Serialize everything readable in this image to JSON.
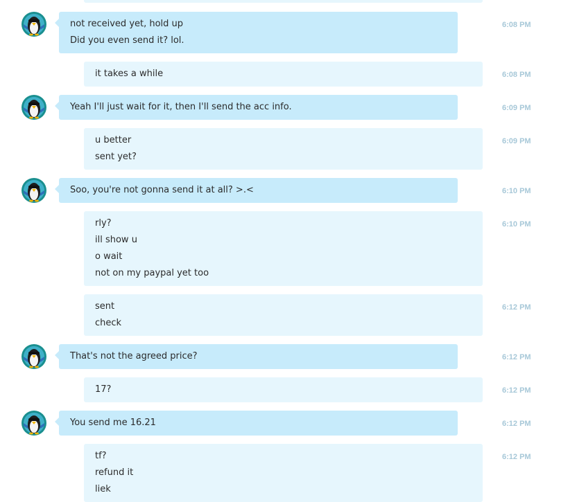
{
  "avatar_icon": "penguin-with-sunglasses",
  "colors": {
    "incoming_bubble": "#c7ebfb",
    "outgoing_bubble": "#e6f6fd",
    "timestamp": "#a7c8d8",
    "avatar_ring": "#1a8f8f"
  },
  "messages": [
    {
      "direction": "in",
      "time": "6:08 PM",
      "lines": [
        "not received yet, hold up",
        "Did you even send it? lol."
      ]
    },
    {
      "direction": "out",
      "time": "6:08 PM",
      "lines": [
        "it takes a while"
      ]
    },
    {
      "direction": "in",
      "time": "6:09 PM",
      "lines": [
        "Yeah I'll just wait for it, then I'll send the acc info."
      ]
    },
    {
      "direction": "out",
      "time": "6:09 PM",
      "lines": [
        "u better",
        "sent yet?"
      ]
    },
    {
      "direction": "in",
      "time": "6:10 PM",
      "lines": [
        "Soo, you're not gonna send it at all? >.<"
      ]
    },
    {
      "direction": "out",
      "time": "6:10 PM",
      "lines": [
        "rly?",
        "ill show u",
        "o wait",
        "not on my paypal yet too"
      ]
    },
    {
      "direction": "out",
      "time": "6:12 PM",
      "lines": [
        "sent",
        "check"
      ]
    },
    {
      "direction": "in",
      "time": "6:12 PM",
      "lines": [
        "That's not the agreed price?"
      ]
    },
    {
      "direction": "out",
      "time": "6:12 PM",
      "lines": [
        "17?"
      ]
    },
    {
      "direction": "in",
      "time": "6:12 PM",
      "lines": [
        "You send me 16.21"
      ]
    },
    {
      "direction": "out",
      "time": "6:12 PM",
      "lines": [
        "tf?",
        "refund it",
        "liek"
      ]
    }
  ]
}
